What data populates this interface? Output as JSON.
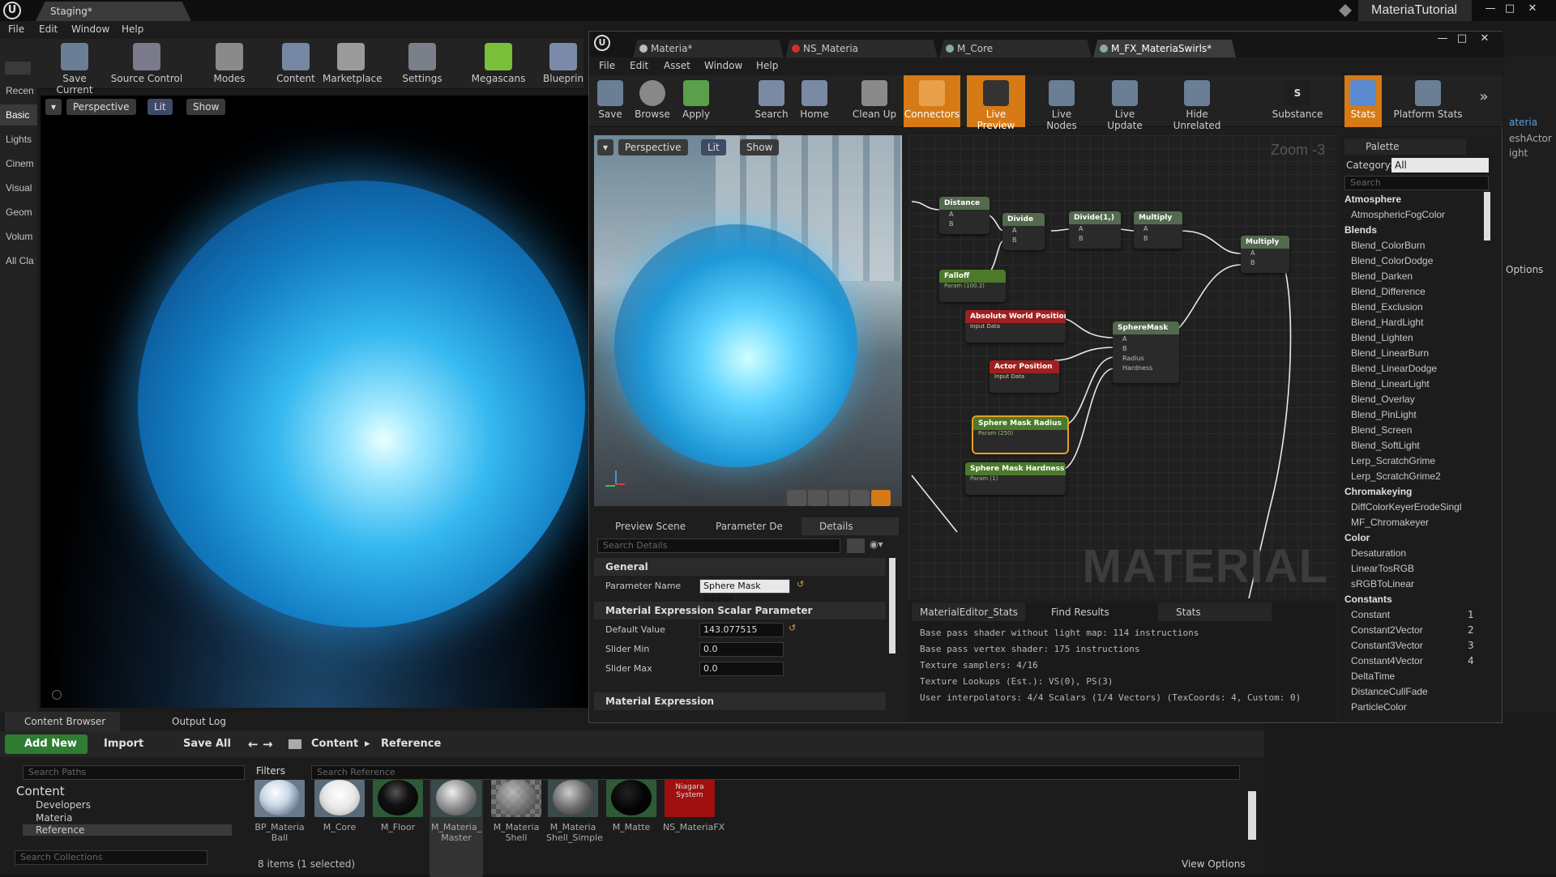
{
  "main": {
    "level_tab": "Staging*",
    "app_title": "MateriaTutorial",
    "menu": [
      "File",
      "Edit",
      "Window",
      "Help"
    ],
    "toolbar": [
      "Save Current",
      "Source Control",
      "Modes",
      "Content",
      "Marketplace",
      "Settings",
      "Megascans",
      "Blueprin"
    ],
    "left_strip": [
      "Recen",
      "Basic",
      "Lights",
      "Cinem",
      "Visual",
      "Geom",
      "Volum",
      "All Cla"
    ],
    "viewport": {
      "perspective": "Perspective",
      "lit": "Lit",
      "show": "Show"
    }
  },
  "content_browser": {
    "tabs": [
      "Content Browser",
      "Output Log"
    ],
    "add_new": "Add New",
    "import": "Import",
    "save_all": "Save All",
    "path_root": "Content",
    "path_leaf": "Reference",
    "search_paths_placeholder": "Search Paths",
    "filters": "Filters",
    "search_reference_placeholder": "Search Reference",
    "search_collections_placeholder": "Search Collections",
    "tree": [
      "Content",
      "Developers",
      "Materia",
      "Reference"
    ],
    "assets": [
      {
        "name": "BP_Materia Ball",
        "color": "#c8d8e8"
      },
      {
        "name": "M_Core",
        "color": "#e8e8e8"
      },
      {
        "name": "M_Floor",
        "color": "#111111"
      },
      {
        "name": "M_Materia_ Master",
        "color": "#8a8a8a"
      },
      {
        "name": "M_Materia Shell",
        "color": "#7c7c7c"
      },
      {
        "name": "M_Materia Shell_Simple",
        "color": "#6a6a6a"
      },
      {
        "name": "M_Matte",
        "color": "#050505"
      },
      {
        "name": "NS_MateriaFX",
        "color": "#a01010"
      }
    ],
    "niagara_label": "Niagara System",
    "status": "8 items (1 selected)",
    "view_options": "View Options"
  },
  "material_editor": {
    "tabs": [
      "Materia*",
      "NS_Materia",
      "M_Core",
      "M_FX_MateriaSwirls*"
    ],
    "menu": [
      "File",
      "Edit",
      "Asset",
      "Window",
      "Help"
    ],
    "toolbar": [
      "Save",
      "Browse",
      "Apply",
      "Search",
      "Home",
      "Clean Up",
      "Connectors",
      "Live Preview",
      "Live Nodes",
      "Live Update",
      "Hide Unrelated",
      "Substance",
      "Stats",
      "Platform Stats"
    ],
    "preview": {
      "perspective": "Perspective",
      "lit": "Lit",
      "show": "Show"
    },
    "details_tabs": [
      "Preview Scene",
      "Parameter De",
      "Details"
    ],
    "details_search_placeholder": "Search Details",
    "details": {
      "general": "General",
      "parameter_name_label": "Parameter Name",
      "parameter_name_value": "Sphere Mask Radius",
      "scalar_section": "Material Expression Scalar Parameter",
      "default_value_label": "Default Value",
      "default_value": "143.077515",
      "slider_min_label": "Slider Min",
      "slider_min": "0.0",
      "slider_max_label": "Slider Max",
      "slider_max": "0.0",
      "next_section": "Material Expression"
    },
    "graph": {
      "zoom": "Zoom -3",
      "watermark": "MATERIAL",
      "nodes": [
        {
          "title": "Distance",
          "pins": [
            "A",
            "B"
          ]
        },
        {
          "title": "Divide",
          "pins": [
            "A",
            "B"
          ]
        },
        {
          "title": "Divide(1,)",
          "pins": [
            "A",
            "B"
          ]
        },
        {
          "title": "Multiply",
          "pins": [
            "A",
            "B"
          ]
        },
        {
          "title": "Multiply",
          "pins": [
            "A",
            "B"
          ]
        },
        {
          "title": "Falloff",
          "sub": "Param (100.2)"
        },
        {
          "title": "Absolute World Position",
          "sub": "Input Data"
        },
        {
          "title": "Actor Position",
          "sub": "Input Data"
        },
        {
          "title": "SphereMask",
          "pins": [
            "A",
            "B",
            "Radius",
            "Hardness"
          ]
        },
        {
          "title": "Sphere Mask Radius",
          "sub": "Param (250)"
        },
        {
          "title": "Sphere Mask Hardness",
          "sub": "Param (1)"
        }
      ]
    },
    "stats_tabs": [
      "MaterialEditor_Stats",
      "Find Results",
      "Stats"
    ],
    "stats": [
      "Base pass shader without light map: 114 instructions",
      "Base pass vertex shader: 175 instructions",
      "Texture samplers: 4/16",
      "Texture Lookups (Est.): VS(0), PS(3)",
      "User interpolators: 4/4 Scalars (1/4 Vectors) (TexCoords: 4, Custom: 0)"
    ],
    "palette": {
      "title": "Palette",
      "category_label": "Category:",
      "category_value": "All",
      "search_placeholder": "Search",
      "entries": [
        {
          "cat": "Atmosphere"
        },
        {
          "item": "AtmosphericFogColor"
        },
        {
          "cat": "Blends"
        },
        {
          "item": "Blend_ColorBurn"
        },
        {
          "item": "Blend_ColorDodge"
        },
        {
          "item": "Blend_Darken"
        },
        {
          "item": "Blend_Difference"
        },
        {
          "item": "Blend_Exclusion"
        },
        {
          "item": "Blend_HardLight"
        },
        {
          "item": "Blend_Lighten"
        },
        {
          "item": "Blend_LinearBurn"
        },
        {
          "item": "Blend_LinearDodge"
        },
        {
          "item": "Blend_LinearLight"
        },
        {
          "item": "Blend_Overlay"
        },
        {
          "item": "Blend_PinLight"
        },
        {
          "item": "Blend_Screen"
        },
        {
          "item": "Blend_SoftLight"
        },
        {
          "item": "Lerp_ScratchGrime"
        },
        {
          "item": "Lerp_ScratchGrime2"
        },
        {
          "cat": "Chromakeying"
        },
        {
          "item": "DiffColorKeyerErodeSingl"
        },
        {
          "item": "MF_Chromakeyer"
        },
        {
          "cat": "Color"
        },
        {
          "item": "Desaturation"
        },
        {
          "item": "LinearTosRGB"
        },
        {
          "item": "sRGBToLinear"
        },
        {
          "cat": "Constants"
        },
        {
          "item": "Constant",
          "key": "1"
        },
        {
          "item": "Constant2Vector",
          "key": "2"
        },
        {
          "item": "Constant3Vector",
          "key": "3"
        },
        {
          "item": "Constant4Vector",
          "key": "4"
        },
        {
          "item": "DeltaTime"
        },
        {
          "item": "DistanceCullFade"
        },
        {
          "item": "ParticleColor"
        }
      ]
    }
  },
  "right_partial": {
    "text1": "ateria",
    "text2": "eshActor",
    "text3": "ight",
    "options": "Options"
  }
}
